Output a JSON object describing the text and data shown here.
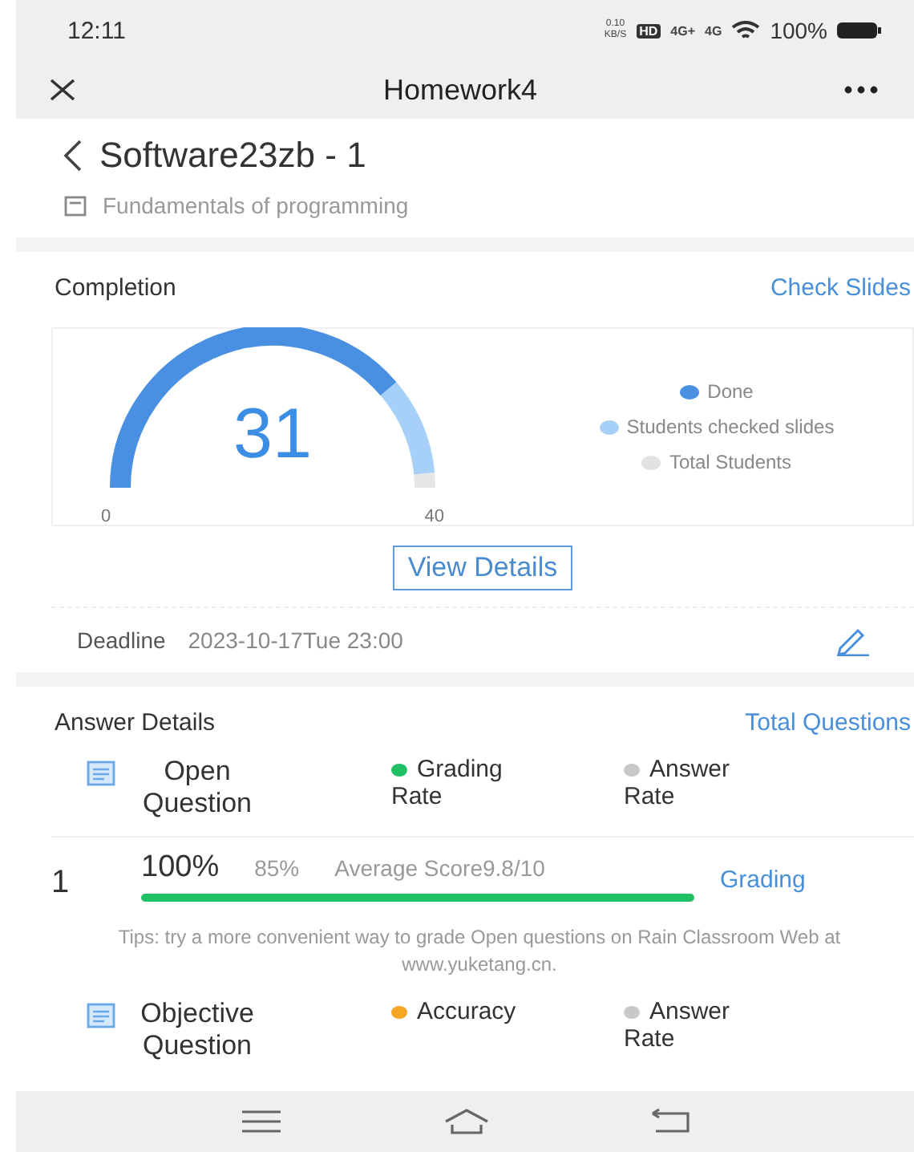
{
  "status_bar": {
    "time": "12:11",
    "net_speed": "0.10",
    "net_unit": "KB/S",
    "hd": "HD",
    "sim1": "4G+",
    "sim2": "4G",
    "battery": "100%"
  },
  "nav": {
    "title": "Homework4"
  },
  "class_info": {
    "name": "Software23zb - 1",
    "course": "Fundamentals of programming"
  },
  "completion": {
    "title": "Completion",
    "link": "Check Slides",
    "value": "31",
    "min": "0",
    "max": "40",
    "legend": [
      {
        "label": "Done",
        "color": "#4a90e2"
      },
      {
        "label": "Students checked slides",
        "color": "#a6d0f7"
      },
      {
        "label": "Total Students",
        "color": "#e2e2e2"
      }
    ],
    "button": "View Details"
  },
  "deadline": {
    "label": "Deadline",
    "value": "2023-10-17Tue 23:00"
  },
  "answers": {
    "title": "Answer Details",
    "link": "Total Questions",
    "groups": [
      {
        "title": "Open Question",
        "metrics": [
          {
            "label": "Grading Rate",
            "color": "#22c065"
          },
          {
            "label": "Answer Rate",
            "color": "#c8c8c8"
          }
        ],
        "rows": [
          {
            "number": "1",
            "primary": "100%",
            "secondary": "85%",
            "score": "Average Score9.8/10",
            "action": "Grading"
          }
        ],
        "tip": "Tips: try a more convenient way to grade Open questions on Rain Classroom Web at www.yuketang.cn."
      },
      {
        "title": "Objective Question",
        "metrics": [
          {
            "label": "Accuracy",
            "color": "#f5a623"
          },
          {
            "label": "Answer Rate",
            "color": "#c8c8c8"
          }
        ]
      }
    ]
  }
}
